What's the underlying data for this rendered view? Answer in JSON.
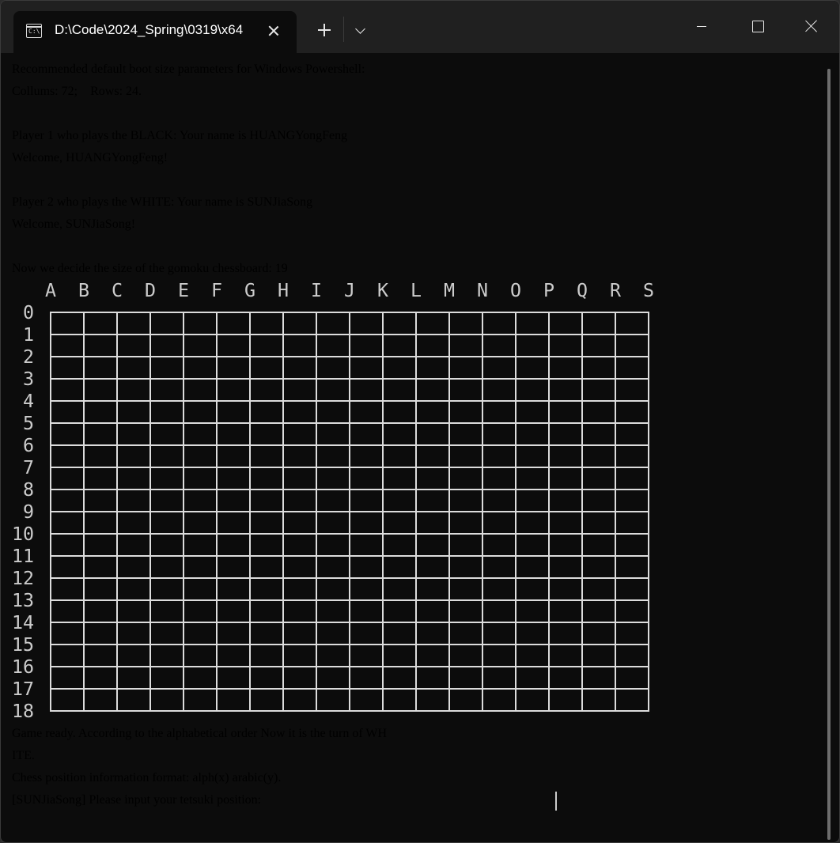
{
  "window": {
    "tab_title": "D:\\Code\\2024_Spring\\0319\\x64",
    "tab_icon": "terminal-icon",
    "controls": [
      "new-tab-icon",
      "dropdown-icon",
      "minimize-icon",
      "maximize-icon",
      "close-icon"
    ]
  },
  "terminal": {
    "lines": [
      "Recommended default boot size parameters for Windows Powershell:",
      "Collums: 72;    Rows: 24.",
      "",
      "Player 1 who plays the BLACK: Your name is HUANGYongFeng",
      "Welcome, HUANGYongFeng!",
      "",
      "Player 2 who plays the WHITE: Your name is SUNJiaSong",
      "Welcome, SUNJiaSong!",
      "",
      "Now we decide the size of the gomoku chessboard: 19"
    ],
    "board": {
      "size": 19,
      "columns": [
        "A",
        "B",
        "C",
        "D",
        "E",
        "F",
        "G",
        "H",
        "I",
        "J",
        "K",
        "L",
        "M",
        "N",
        "O",
        "P",
        "Q",
        "R",
        "S"
      ],
      "rows": [
        "0",
        "1",
        "2",
        "3",
        "4",
        "5",
        "6",
        "7",
        "8",
        "9",
        "10",
        "11",
        "12",
        "13",
        "14",
        "15",
        "16",
        "17",
        "18"
      ]
    },
    "after_lines": [
      "Game ready. According to the alphabetical order Now it is the turn of WH",
      "ITE.",
      "Chess position information format: alph(x) arabic(y).",
      "[SUNJiaSong] Please input your tetsuki position: "
    ]
  },
  "colors": {
    "terminal_bg": "#0c0c0c",
    "text": "#cccccc",
    "titlebar_bg": "#202020"
  }
}
